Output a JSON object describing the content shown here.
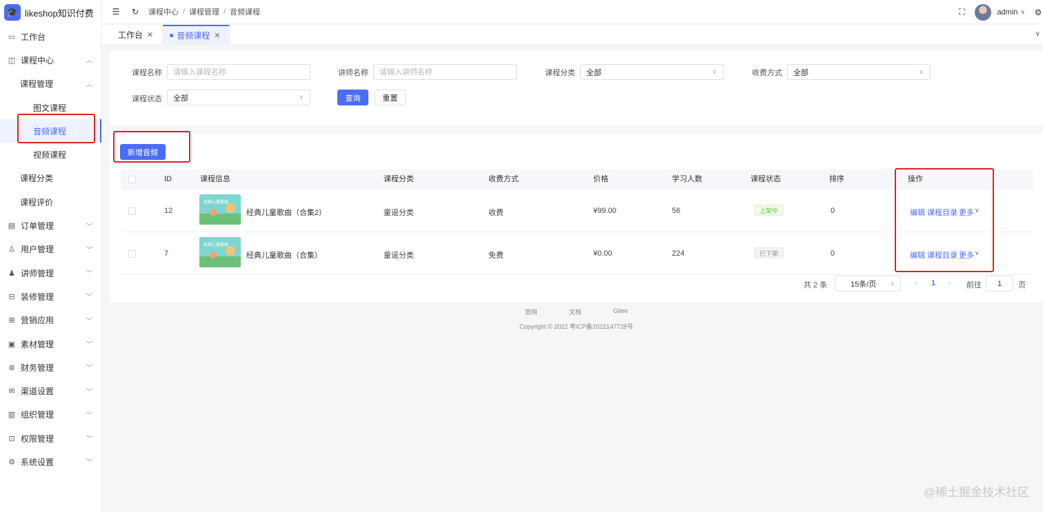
{
  "app": {
    "title": "likeshop知识付费"
  },
  "sidebar": {
    "items": [
      {
        "label": "工作台",
        "icon": "monitor-icon"
      },
      {
        "label": "课程中心",
        "icon": "columns-icon",
        "expanded": true
      },
      {
        "label": "课程管理",
        "expanded": true
      },
      {
        "label": "图文课程"
      },
      {
        "label": "音频课程",
        "active": true
      },
      {
        "label": "视频课程"
      },
      {
        "label": "课程分类"
      },
      {
        "label": "课程评价"
      },
      {
        "label": "订单管理",
        "icon": "clipboard-icon"
      },
      {
        "label": "用户管理",
        "icon": "user-icon"
      },
      {
        "label": "讲师管理",
        "icon": "teacher-icon"
      },
      {
        "label": "装修管理",
        "icon": "palette-icon"
      },
      {
        "label": "营销应用",
        "icon": "marketing-icon"
      },
      {
        "label": "素材管理",
        "icon": "image-icon"
      },
      {
        "label": "财务管理",
        "icon": "yen-icon"
      },
      {
        "label": "渠道设置",
        "icon": "mail-icon"
      },
      {
        "label": "组织管理",
        "icon": "building-icon"
      },
      {
        "label": "权限管理",
        "icon": "lock-icon"
      },
      {
        "label": "系统设置",
        "icon": "gear-icon"
      }
    ]
  },
  "header": {
    "breadcrumb": [
      "课程中心",
      "课程管理",
      "音频课程"
    ],
    "username": "admin"
  },
  "tabs": [
    {
      "label": "工作台"
    },
    {
      "label": "音频课程",
      "active": true
    }
  ],
  "filters": {
    "course_name": {
      "label": "课程名称",
      "placeholder": "请输入课程名称"
    },
    "teacher_name": {
      "label": "讲师名称",
      "placeholder": "请输入讲师名称"
    },
    "category": {
      "label": "课程分类",
      "value": "全部"
    },
    "pay_type": {
      "label": "收费方式",
      "value": "全部"
    },
    "status": {
      "label": "课程状态",
      "value": "全部"
    },
    "query_label": "查询",
    "reset_label": "重置"
  },
  "actions": {
    "add_label": "新增音频"
  },
  "table": {
    "columns": [
      "ID",
      "课程信息",
      "课程分类",
      "收费方式",
      "价格",
      "学习人数",
      "课程状态",
      "排序",
      "操作"
    ],
    "rows": [
      {
        "id": "12",
        "name": "经典儿童歌曲（合集2）",
        "category": "童谣分类",
        "pay_type": "收费",
        "price": "¥99.00",
        "learners": "56",
        "status": "上架中",
        "sort": "0",
        "thumb_text": "经典儿童歌曲"
      },
      {
        "id": "7",
        "name": "经典儿童歌曲（合集）",
        "category": "童谣分类",
        "pay_type": "免费",
        "price": "¥0.00",
        "learners": "224",
        "status": "已下架",
        "sort": "0",
        "thumb_text": "经典儿童歌曲"
      }
    ],
    "row_actions": {
      "edit": "编辑",
      "catalog": "课程目录",
      "more": "更多"
    }
  },
  "pagination": {
    "total": "共 2 条",
    "page_size": "15条/页",
    "current": "1",
    "goto_label": "前往",
    "goto_value": "1",
    "page_unit": "页"
  },
  "footer": {
    "links": [
      "官网",
      "文档",
      "Gitee"
    ],
    "copyright": "Copyright © 2022 粤ICP备2022147728号"
  },
  "watermark": "@稀土掘金技术社区",
  "colors": {
    "primary": "#4a6cf7",
    "annotation": "#e02020"
  }
}
